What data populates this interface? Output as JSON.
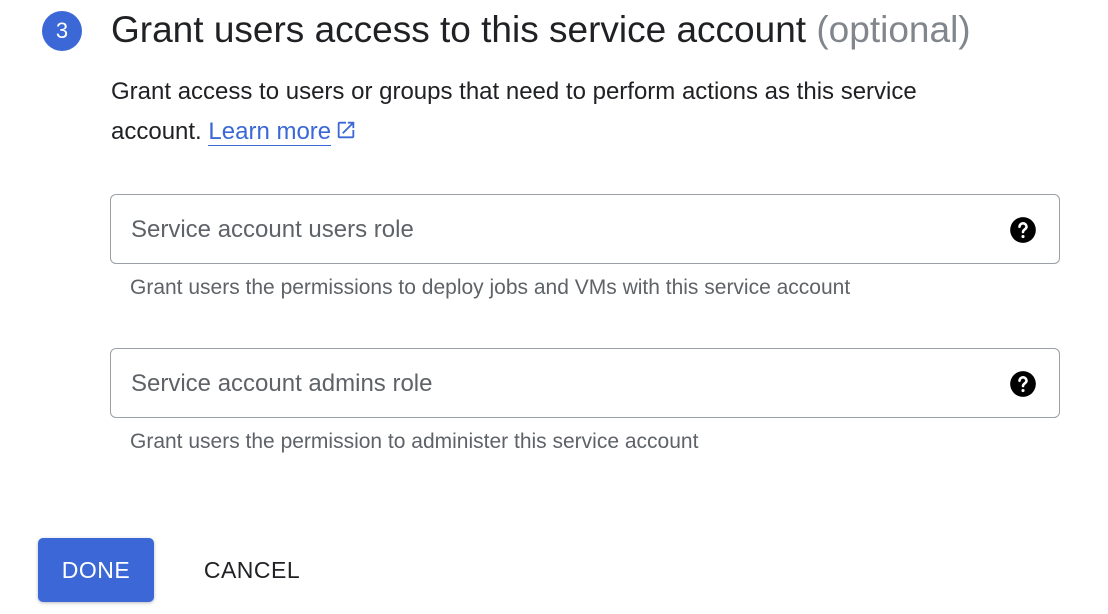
{
  "step": {
    "number": "3",
    "title": "Grant users access to this service account",
    "optional_label": "(optional)"
  },
  "description": {
    "text": "Grant access to users or groups that need to perform actions as this service account.",
    "link_label": "Learn more",
    "link_icon": "open-in-new-icon"
  },
  "fields": {
    "users_role": {
      "placeholder": "Service account users role",
      "value": "",
      "help_icon": "help-circle-icon",
      "hint": "Grant users the permissions to deploy jobs and VMs with this service account"
    },
    "admins_role": {
      "placeholder": "Service account admins role",
      "value": "",
      "help_icon": "help-circle-icon",
      "hint": "Grant users the permission to administer this service account"
    }
  },
  "actions": {
    "done_label": "DONE",
    "cancel_label": "CANCEL"
  },
  "colors": {
    "accent": "#3b68d6",
    "text": "#202124",
    "secondary_text": "#5f6368",
    "muted_title": "#80868b",
    "border": "#9aa0a6"
  }
}
